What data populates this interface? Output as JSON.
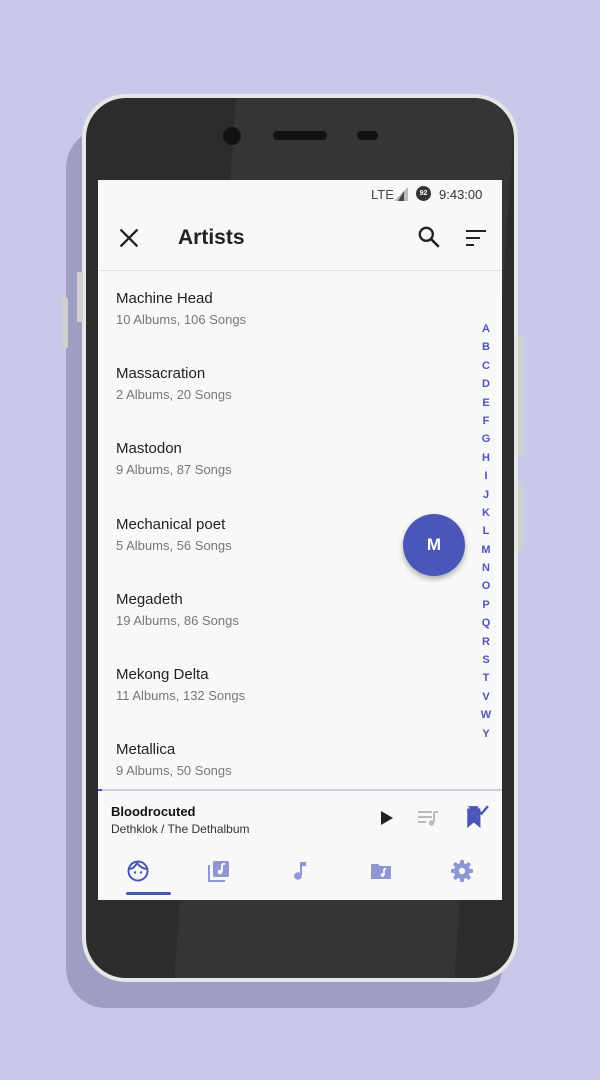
{
  "status_bar": {
    "network": "LTE",
    "battery": "92",
    "time": "9:43:00"
  },
  "toolbar": {
    "title": "Artists"
  },
  "artists": [
    {
      "name": "Machine Head",
      "info": "10 Albums, 106 Songs"
    },
    {
      "name": "Massacration",
      "info": "2 Albums, 20 Songs"
    },
    {
      "name": "Mastodon",
      "info": "9 Albums, 87 Songs"
    },
    {
      "name": "Mechanical poet",
      "info": "5 Albums, 56 Songs"
    },
    {
      "name": "Megadeth",
      "info": "19 Albums, 86 Songs"
    },
    {
      "name": "Mekong Delta",
      "info": "11 Albums, 132 Songs"
    },
    {
      "name": "Metallica",
      "info": "9 Albums, 50 Songs"
    }
  ],
  "alphabet_index": [
    "A",
    "B",
    "C",
    "D",
    "E",
    "F",
    "G",
    "H",
    "I",
    "J",
    "K",
    "L",
    "M",
    "N",
    "O",
    "P",
    "Q",
    "R",
    "S",
    "T",
    "V",
    "W",
    "Y"
  ],
  "fast_scroll_letter": "M",
  "now_playing": {
    "title": "Bloodrocuted",
    "subtitle": "Dethklok / The Dethalbum",
    "progress": 0.01
  },
  "bottom_nav": {
    "items": [
      "artists-tab",
      "albums-tab",
      "songs-tab",
      "folders-tab",
      "settings-tab"
    ],
    "selected": "artists-tab"
  },
  "colors": {
    "accent": "#4a56b8",
    "background": "#c8c8e8",
    "nav_inactive": "#8e96d4"
  }
}
